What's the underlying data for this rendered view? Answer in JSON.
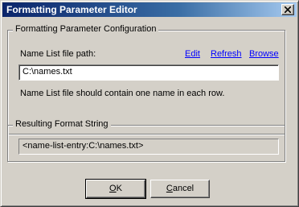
{
  "window": {
    "title": "Formatting Parameter Editor",
    "close_glyph": "close-icon"
  },
  "config_group": {
    "caption": "Formatting  Parameter Configuration",
    "file_label": "Name List file path:",
    "links": {
      "edit": "Edit",
      "refresh": "Refresh",
      "browse": "Browse"
    },
    "path_value": "C:\\names.txt",
    "hint": "Name List file should contain one name in each row."
  },
  "result_group": {
    "caption": "Resulting Format String",
    "value": "<name-list-entry:C:\\names.txt>"
  },
  "buttons": {
    "ok_mnemonic": "O",
    "ok_rest": "K",
    "cancel_mnemonic": "C",
    "cancel_rest": "ancel"
  },
  "colors": {
    "title_start": "#0a246a",
    "title_end": "#a6caf0",
    "link": "#0000ff",
    "face": "#d4d0c8"
  }
}
